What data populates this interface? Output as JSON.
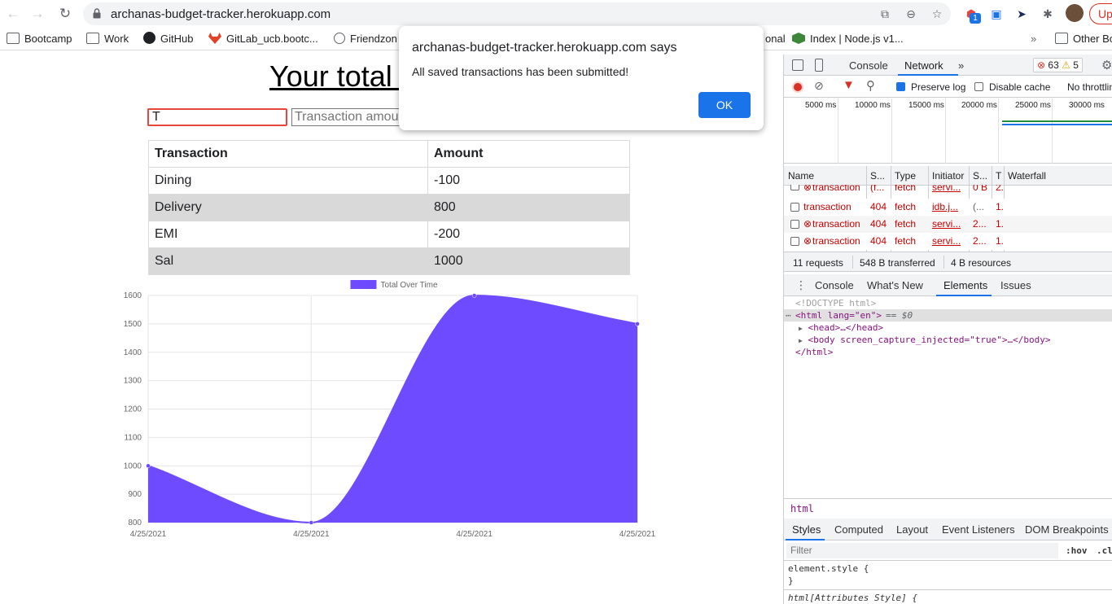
{
  "browser": {
    "url": "archanas-budget-tracker.herokuapp.com",
    "ext_badge": "1",
    "update_label": "Up"
  },
  "bookmarks": {
    "items": [
      "Bootcamp",
      "Work",
      "GitHub",
      "GitLab_ucb.bootc...",
      "Friendzon",
      "onal",
      "Index | Node.js v1..."
    ],
    "overflow": "»",
    "other": "Other Bo"
  },
  "page": {
    "title": "Your total i",
    "name_input_value": "T",
    "amount_placeholder": "Transaction amount",
    "table": {
      "headers": [
        "Transaction",
        "Amount"
      ],
      "rows": [
        [
          "Dining",
          "-100"
        ],
        [
          "Delivery",
          "800"
        ],
        [
          "EMI",
          "-200"
        ],
        [
          "Sal",
          "1000"
        ]
      ]
    }
  },
  "chart_data": {
    "type": "area",
    "legend": "Total Over Time",
    "x": [
      "4/25/2021",
      "4/25/2021",
      "4/25/2021",
      "4/25/2021"
    ],
    "values": [
      1000,
      800,
      1600,
      1500
    ],
    "ylim": [
      800,
      1600
    ],
    "yticks": [
      800,
      900,
      1000,
      1100,
      1200,
      1300,
      1400,
      1500,
      1600
    ],
    "color": "#6f4bff",
    "grid": true,
    "legend_position": "top"
  },
  "dialog": {
    "title": "archanas-budget-tracker.herokuapp.com says",
    "message": "All saved transactions has been submitted!",
    "ok_label": "OK"
  },
  "devtools": {
    "top_tabs": [
      "Console",
      "Network",
      "»"
    ],
    "errors": "63",
    "warnings": "5",
    "preserve_log": "Preserve log",
    "disable_cache": "Disable cache",
    "throttling": "No throttlin",
    "timeline": [
      "5000 ms",
      "10000 ms",
      "15000 ms",
      "20000 ms",
      "25000 ms",
      "30000 ms"
    ],
    "columns": [
      "Name",
      "S...",
      "Type",
      "Initiator",
      "S...",
      "T",
      "Waterfall"
    ],
    "rows": [
      {
        "name": "transaction",
        "status": "(f...",
        "type": "fetch",
        "initiator": "servi...",
        "size": "0 B",
        "time": "2.",
        "error_icon": true
      },
      {
        "name": "transaction",
        "status": "404",
        "type": "fetch",
        "initiator": "idb.j...",
        "size": "(...",
        "time": "1.",
        "error_icon": false
      },
      {
        "name": "transaction",
        "status": "404",
        "type": "fetch",
        "initiator": "servi...",
        "size": "2...",
        "time": "1.",
        "error_icon": true
      },
      {
        "name": "transaction",
        "status": "404",
        "type": "fetch",
        "initiator": "servi...",
        "size": "2...",
        "time": "1.",
        "error_icon": true
      }
    ],
    "summary": [
      "11 requests",
      "548 B transferred",
      "4 B resources"
    ],
    "drawer_tabs": [
      "Console",
      "What's New",
      "Elements",
      "Issues"
    ],
    "dom": {
      "doctype": "<!DOCTYPE html>",
      "html_open": "<html lang=\"en\">",
      "html_suffix": "== $0",
      "head": "<head>…</head>",
      "body": "<body screen_capture_injected=\"true\">…</body>",
      "html_close": "</html>"
    },
    "breadcrumb": "html",
    "style_tabs": [
      "Styles",
      "Computed",
      "Layout",
      "Event Listeners",
      "DOM Breakpoints"
    ],
    "filter_placeholder": "Filter",
    "hov": ":hov",
    "cls": ".cls",
    "element_style": "element.style {",
    "close_brace": "}",
    "attr_style": "html[Attributes Style] {"
  }
}
